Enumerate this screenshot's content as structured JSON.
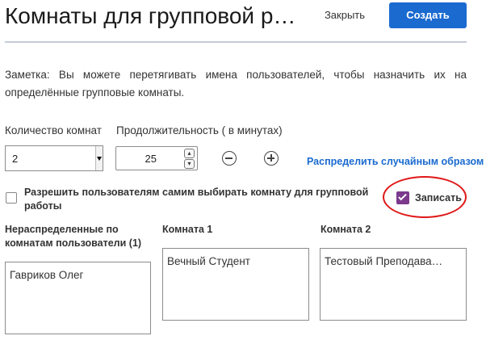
{
  "header": {
    "title": "Комнаты для групповой ра…",
    "close_label": "Закрыть",
    "create_label": "Создать"
  },
  "note": "Заметка: Вы можете перетягивать имена пользователей, чтобы назначить их на определённые групповые комнаты.",
  "settings": {
    "room_count_label": "Количество комнат",
    "room_count_value": "2",
    "duration_label": "Продолжительность ( в минутах)",
    "duration_value": "25",
    "random_link": "Распределить случайным образом",
    "self_select_label": "Разрешить пользователям самим выбирать комнату для групповой работы",
    "self_select_checked": false,
    "record_label": "Записать",
    "record_checked": true
  },
  "columns": [
    {
      "header": "Нераспределенные по комнатам пользователи (1)",
      "items": [
        "Гавриков Олег"
      ]
    },
    {
      "header": "Комната 1",
      "items": [
        "Вечный Студент"
      ]
    },
    {
      "header": "Комната 2",
      "items": [
        "Тестовый Преподава…"
      ]
    }
  ],
  "colors": {
    "accent": "#1a6ad0",
    "record_checkbox": "#7b3a8c",
    "highlight_oval": "#e01818"
  },
  "icons": {
    "select_arrow": "chevron-down-icon",
    "spin_up": "chevron-up-icon",
    "spin_down": "chevron-down-icon",
    "decrease": "minus-circle-icon",
    "increase": "plus-circle-icon",
    "record_check": "checkmark-icon"
  }
}
